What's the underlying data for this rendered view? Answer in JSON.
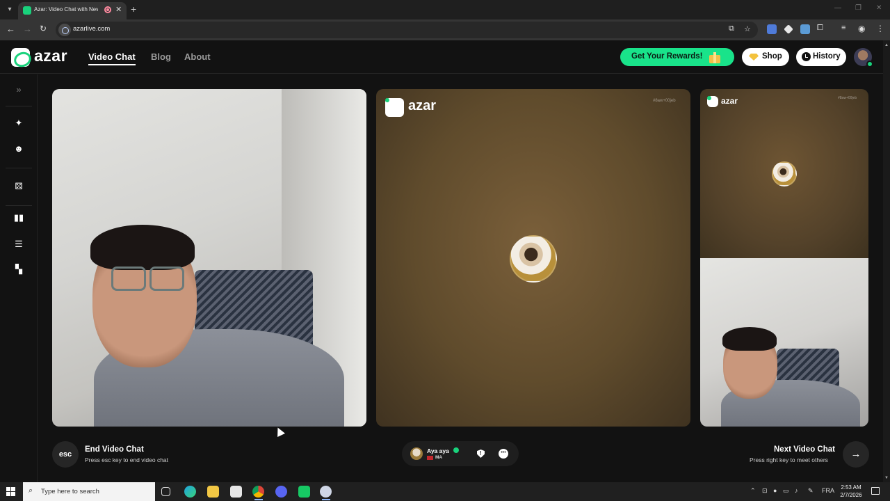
{
  "browser": {
    "tab_title": "Azar: Video Chat with New",
    "url": "azarlive.com"
  },
  "header": {
    "logo_text": "azar",
    "menu": [
      "Video Chat",
      "Blog",
      "About"
    ],
    "rewards_label": "Get Your Rewards!",
    "shop_label": "Shop",
    "history_label": "History"
  },
  "tiles": {
    "logo_text": "azar",
    "watermark": "#8aw+00jeb"
  },
  "controls": {
    "end": {
      "key": "esc",
      "title": "End Video Chat",
      "hint": "Press esc key to end video chat"
    },
    "peer": {
      "name": "Aya aya",
      "country": "MA"
    },
    "next": {
      "title": "Next Video Chat",
      "hint": "Press right key to meet others"
    }
  },
  "taskbar": {
    "search_placeholder": "Type here to search",
    "language": "FRA",
    "time": "2:53 AM",
    "date": "2/7/2026"
  },
  "colors": {
    "brand_green": "#19d27c",
    "rewards_green": "#19e38a",
    "background": "#121212"
  },
  "icons": {
    "rail": [
      "expand-icon",
      "magic-wand-icon",
      "face-filter-icon",
      "gender-filter-icon",
      "layout-split-icon",
      "layout-stack-icon",
      "layout-grid-icon"
    ]
  }
}
